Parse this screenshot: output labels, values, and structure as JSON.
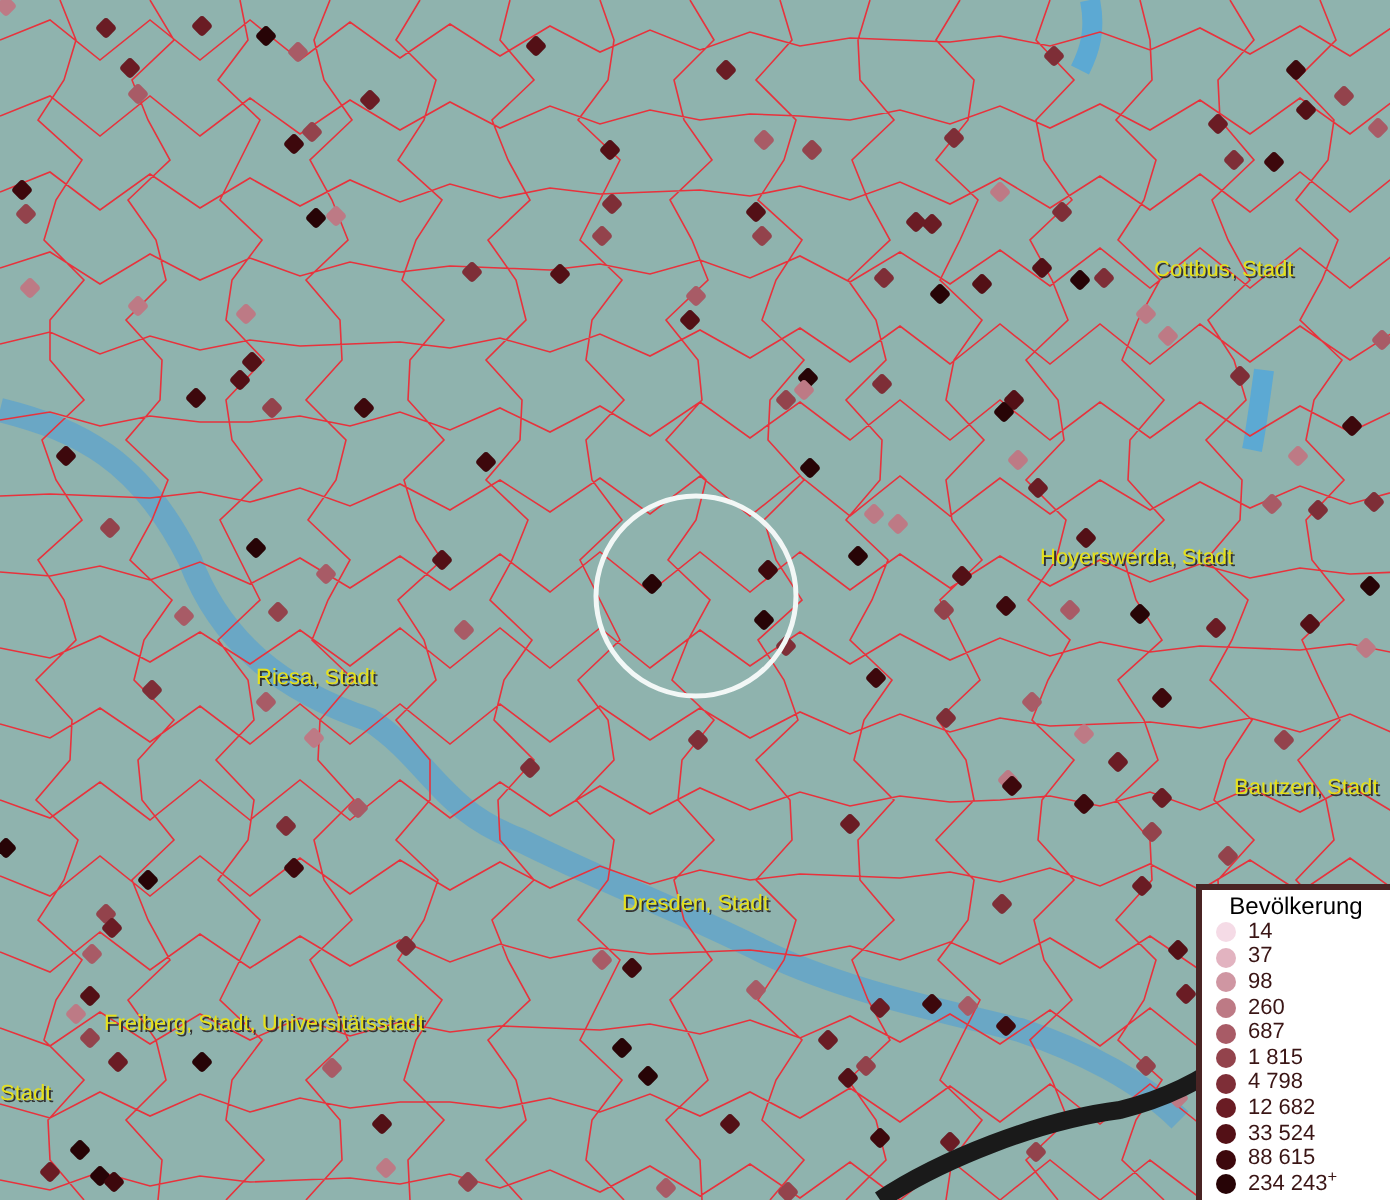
{
  "map": {
    "places": [
      {
        "label": "Cottbus, Stadt"
      },
      {
        "label": "Hoyerswerda, Stadt"
      },
      {
        "label": "Riesa, Stadt"
      },
      {
        "label": "Bautzen, Stadt"
      },
      {
        "label": "Dresden, Stadt"
      },
      {
        "label": "Freiberg, Stadt, Universitätsstadt"
      },
      {
        "label": "Stadt"
      }
    ]
  },
  "legend": {
    "title": "Bevölkerung",
    "items": [
      {
        "label": "14",
        "color": "#f5dbe6"
      },
      {
        "label": "37",
        "color": "#e2b3c0"
      },
      {
        "label": "98",
        "color": "#cf96a2"
      },
      {
        "label": "260",
        "color": "#bd7a85"
      },
      {
        "label": "687",
        "color": "#a85b66"
      },
      {
        "label": "1 815",
        "color": "#93434c"
      },
      {
        "label": "4 798",
        "color": "#7e2e37"
      },
      {
        "label": "12 682",
        "color": "#6a1c24"
      },
      {
        "label": "33 524",
        "color": "#531016"
      },
      {
        "label": "88 615",
        "color": "#3d080c"
      },
      {
        "label": "234 243$^{+}$",
        "color": "#270406"
      }
    ]
  }
}
